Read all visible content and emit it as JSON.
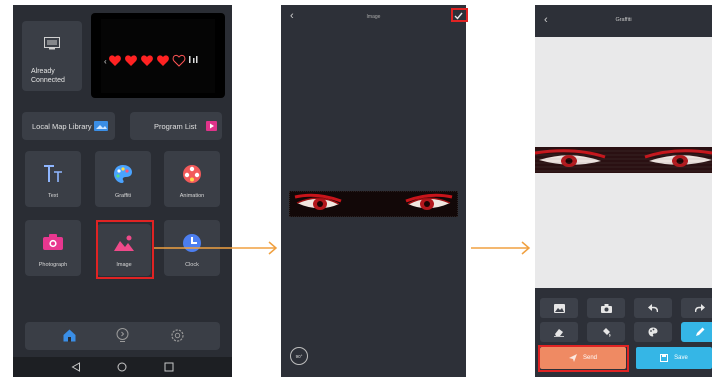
{
  "screen1": {
    "already_connected": "Already\nConnected",
    "local_map_library": "Local Map Library",
    "program_list": "Program List",
    "grid_tiles": [
      {
        "label": "Text",
        "icon": "text-icon"
      },
      {
        "label": "Graffiti",
        "icon": "palette-icon"
      },
      {
        "label": "Animation",
        "icon": "animation-icon"
      },
      {
        "label": "Photograph",
        "icon": "camera-icon"
      },
      {
        "label": "Image",
        "icon": "image-icon"
      },
      {
        "label": "Clock",
        "icon": "clock-icon"
      }
    ],
    "tab_icons": [
      "home-icon",
      "bulb-icon",
      "gear-icon"
    ],
    "system_nav": [
      "back-triangle-icon",
      "home-circle-icon",
      "recent-square-icon"
    ]
  },
  "screen2": {
    "title": "Image",
    "rotate_label": "90°"
  },
  "screen3": {
    "title": "Graffiti",
    "tools_row1": [
      "image-icon",
      "camera-icon",
      "undo-icon",
      "redo-icon"
    ],
    "tools_row2": [
      "eraser-icon",
      "bucket-icon",
      "palette-icon",
      "pen-icon"
    ],
    "send_label": "Send",
    "save_label": "Save"
  },
  "colors": {
    "highlight": "#e02323",
    "connector": "#f0a040",
    "send": "#ef8a63",
    "save": "#35b6e6",
    "tab_active": "#3a8ee6"
  }
}
